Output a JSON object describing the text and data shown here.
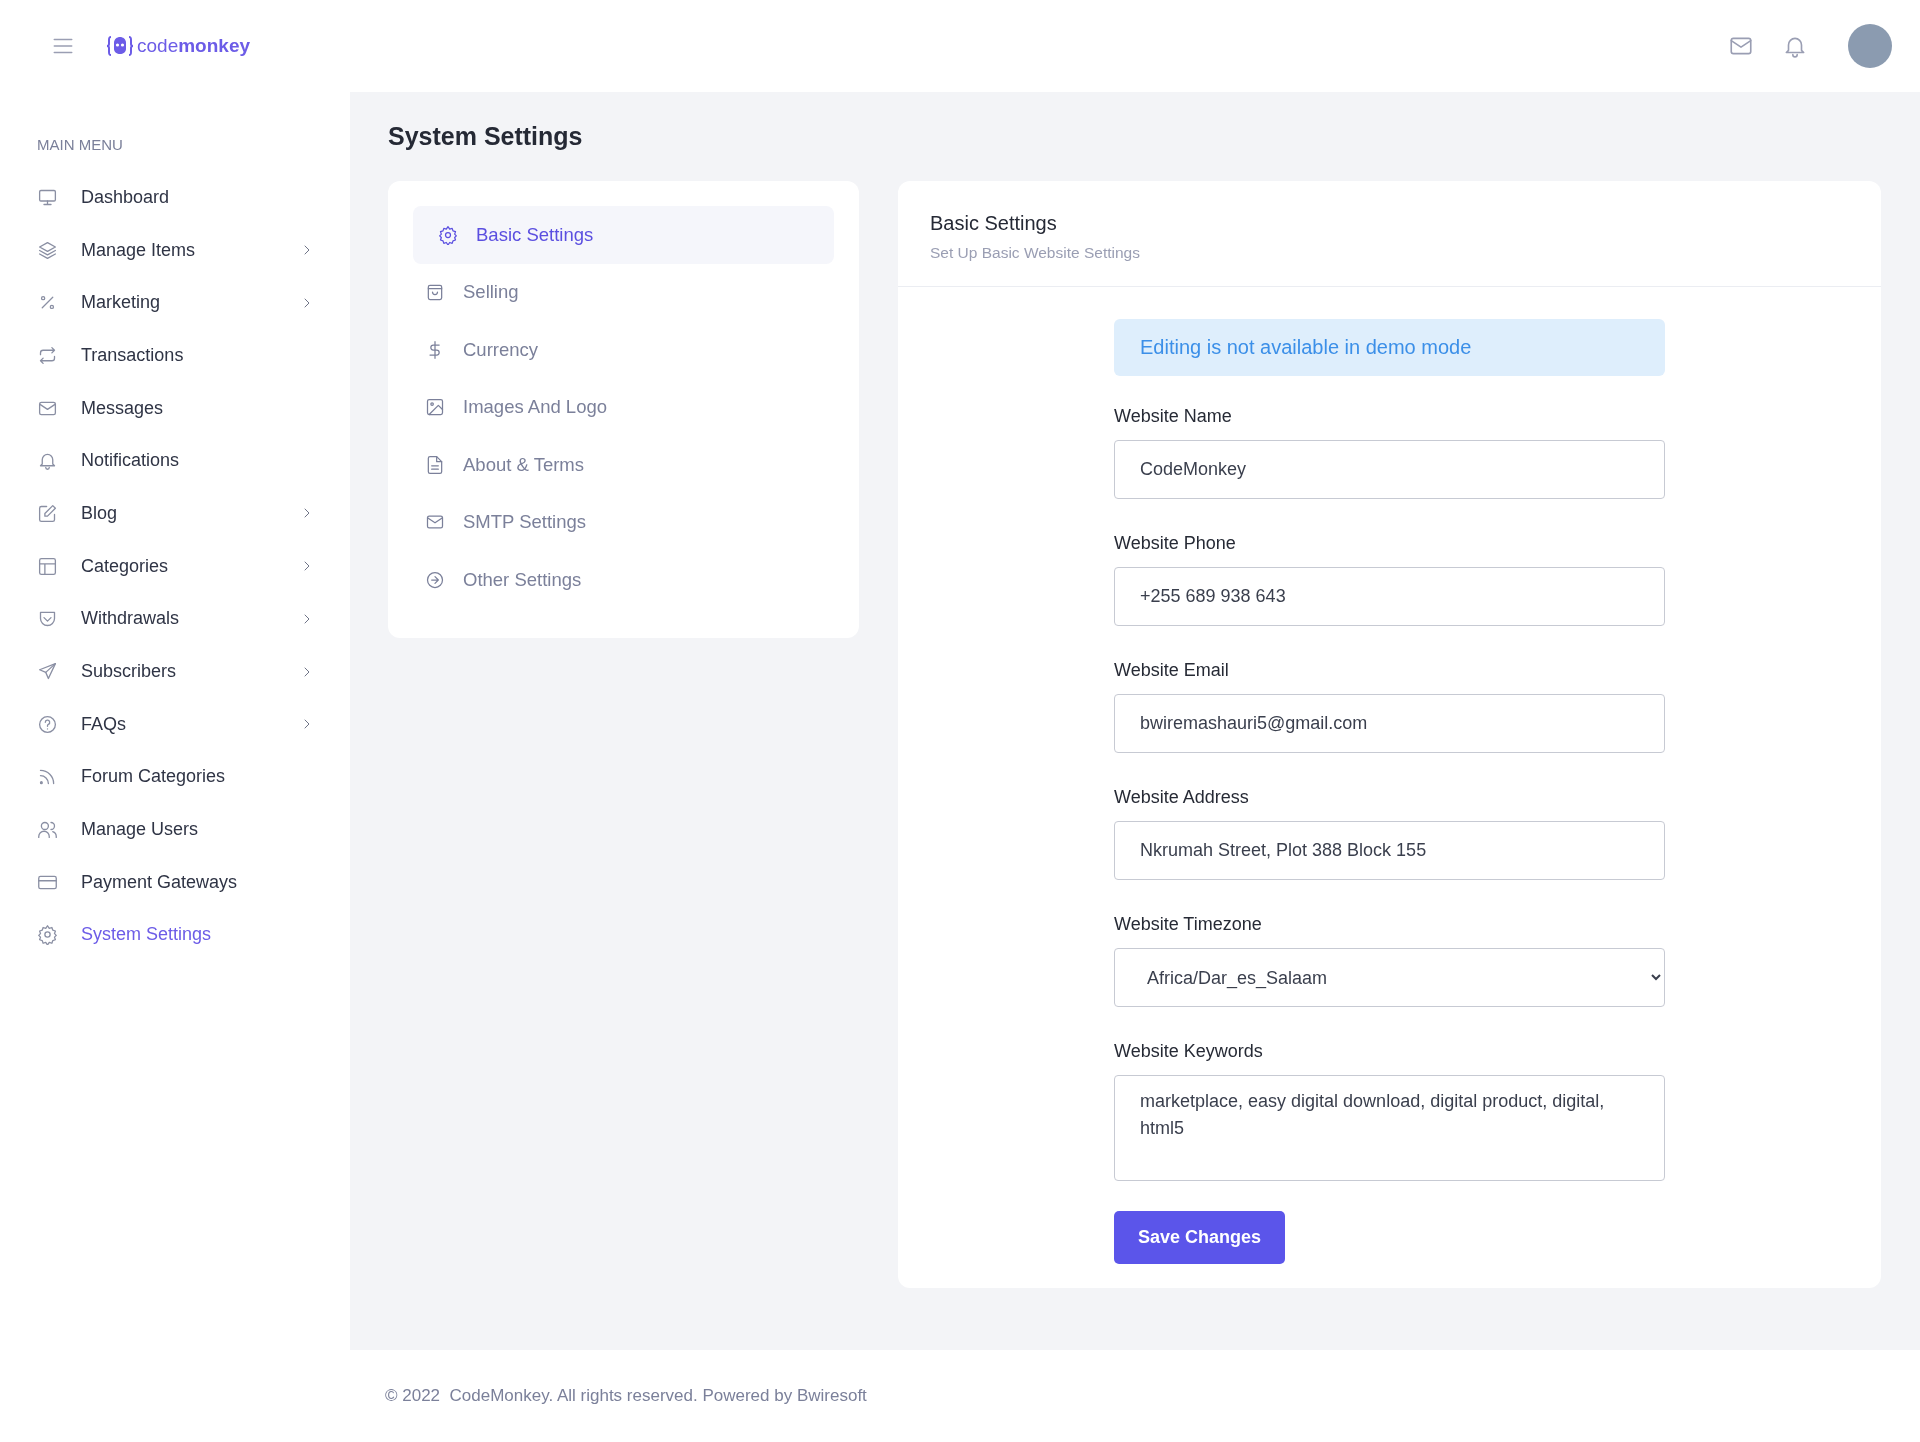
{
  "header": {
    "logo": "code**monkey**"
  },
  "sidebar": {
    "heading": "MAIN MENU",
    "items": [
      {
        "label": "Dashboard",
        "expandable": false,
        "selected": false
      },
      {
        "label": "Manage Items",
        "expandable": true,
        "selected": false
      },
      {
        "label": "Marketing",
        "expandable": true,
        "selected": false
      },
      {
        "label": "Transactions",
        "expandable": false,
        "selected": false
      },
      {
        "label": "Messages",
        "expandable": false,
        "selected": false
      },
      {
        "label": "Notifications",
        "expandable": false,
        "selected": false
      },
      {
        "label": "Blog",
        "expandable": true,
        "selected": false
      },
      {
        "label": "Categories",
        "expandable": true,
        "selected": false
      },
      {
        "label": "Withdrawals",
        "expandable": true,
        "selected": false
      },
      {
        "label": "Subscribers",
        "expandable": true,
        "selected": false
      },
      {
        "label": "FAQs",
        "expandable": true,
        "selected": false
      },
      {
        "label": "Forum Categories",
        "expandable": false,
        "selected": false
      },
      {
        "label": "Manage Users",
        "expandable": false,
        "selected": false
      },
      {
        "label": "Payment Gateways",
        "expandable": false,
        "selected": false
      },
      {
        "label": "System Settings",
        "expandable": false,
        "selected": true
      }
    ]
  },
  "page_title": "System Settings",
  "settings_menu": [
    {
      "label": "Basic Settings",
      "selected": true
    },
    {
      "label": "Selling",
      "selected": false
    },
    {
      "label": "Currency",
      "selected": false
    },
    {
      "label": "Images And Logo",
      "selected": false
    },
    {
      "label": "About & Terms",
      "selected": false
    },
    {
      "label": "SMTP Settings",
      "selected": false
    },
    {
      "label": "Other Settings",
      "selected": false
    }
  ],
  "panel": {
    "title": "Basic Settings",
    "subtitle": "Set Up Basic Website Settings",
    "alert": "Editing is not available in demo mode",
    "fields": [
      {
        "kind": "text",
        "label": "Website Name",
        "value": "CodeMonkey"
      },
      {
        "kind": "text",
        "label": "Website Phone",
        "value": "+255 689 938 643"
      },
      {
        "kind": "text",
        "label": "Website Email",
        "value": "bwiremashauri5@gmail.com"
      },
      {
        "kind": "text",
        "label": "Website Address",
        "value": "Nkrumah Street, Plot 388 Block 155"
      },
      {
        "kind": "select",
        "label": "Website Timezone",
        "value": "Africa/Dar_es_Salaam"
      },
      {
        "kind": "textarea",
        "label": "Website Keywords",
        "value": "marketplace, easy digital download, digital product, digital, html5"
      }
    ],
    "button": "Save Changes"
  },
  "footer": {
    "text": "© 2022  CodeMonkey. All rights reserved. Powered by",
    "link": "Bwiresoft"
  }
}
